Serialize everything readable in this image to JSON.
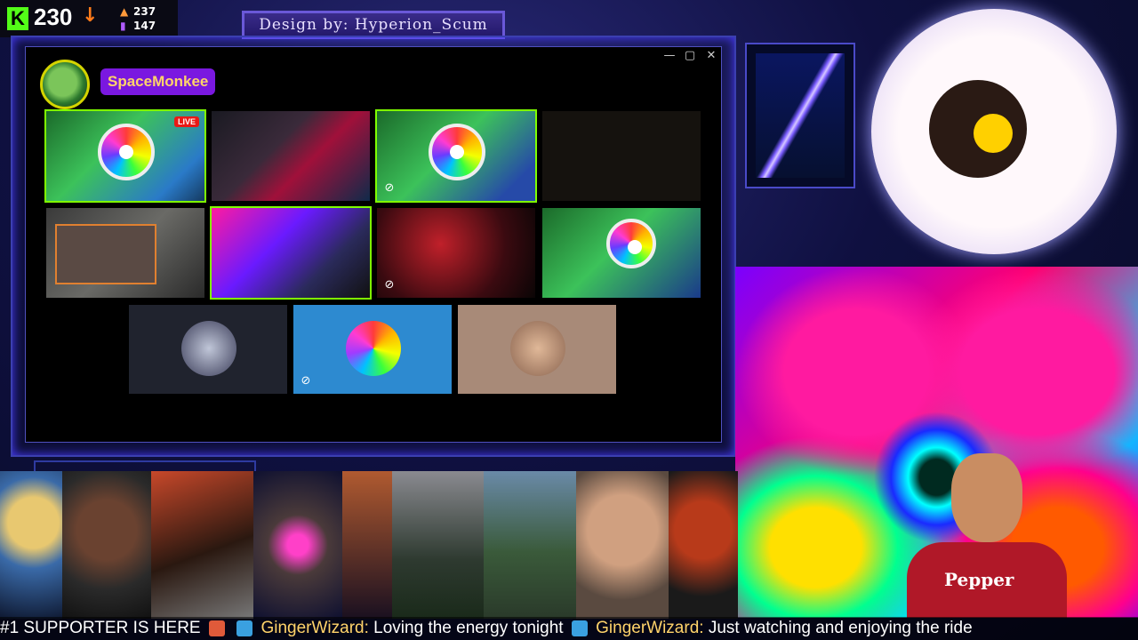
{
  "stats": {
    "viewers": "230",
    "stat_a": "237",
    "stat_b": "147"
  },
  "banner": {
    "text": "Design by: Hyperion_Scum"
  },
  "window": {
    "controls": {
      "minimize": "—",
      "maximize": "▢",
      "close": "✕"
    },
    "channel_name": "SpaceMonkee",
    "live_label": "LIVE"
  },
  "ticker": {
    "prefix": "#1 SUPPORTER IS HERE",
    "messages": [
      {
        "user": "GingerWizard",
        "text": "Loving the energy tonight"
      },
      {
        "user": "GingerWizard",
        "text": "Just watching and enjoying the ride"
      }
    ]
  },
  "streamer": {
    "shirt_text": "Pepper"
  },
  "colors": {
    "kick_green": "#53fc18",
    "frame_purple": "#3b3fb0",
    "channel_pill": "#7a18e0",
    "ticker_user": "#ffd36a"
  }
}
